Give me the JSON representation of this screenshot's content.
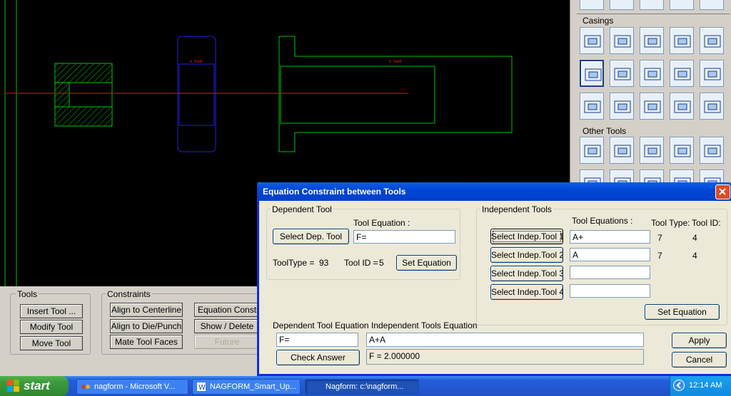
{
  "canvas": {
    "tool_labels": [
      "4. Tool0",
      "5. Tool0"
    ]
  },
  "palette": {
    "casings_title": "Casings",
    "other_tools_title": "Other Tools"
  },
  "bottom_panel": {
    "tools_group": "Tools",
    "insert_tool": "Insert Tool ...",
    "modify_tool": "Modify Tool",
    "move_tool": "Move Tool",
    "constraints_group": "Constraints",
    "align_centerline": "Align to Centerline",
    "align_die_punch": "Align to Die/Punch",
    "mate_tool_faces": "Mate Tool Faces",
    "equation_constraint": "Equation Constraint",
    "show_delete": "Show / Delete",
    "future": "Future"
  },
  "dialog": {
    "title": "Equation Constraint between Tools",
    "dependent_group": "Dependent Tool",
    "tool_equation_label": "Tool Equation :",
    "select_dep_tool": "Select Dep. Tool",
    "dep_equation_value": "F=",
    "tooltype_label": "ToolType =",
    "tooltype_value": "93",
    "toolid_label": "Tool ID =",
    "toolid_value": "5",
    "set_equation_dep": "Set Equation",
    "independent_group": "Independent Tools",
    "tool_equations_header": "Tool Equations :",
    "tool_type_header": "Tool Type:",
    "tool_id_header": "Tool ID:",
    "indep": [
      {
        "button": "Select Indep.Tool 1",
        "equation": "A+",
        "type": "7",
        "id": "4"
      },
      {
        "button": "Select Indep.Tool 2",
        "equation": "A",
        "type": "7",
        "id": "4"
      },
      {
        "button": "Select Indep.Tool 3",
        "equation": "",
        "type": "",
        "id": ""
      },
      {
        "button": "Select Indep.Tool 4",
        "equation": "",
        "type": "",
        "id": ""
      }
    ],
    "set_equation_indep": "Set Equation",
    "dep_tool_equation_label": "Dependent Tool  Equation",
    "indep_tools_equation_label": "Independent Tools Equation",
    "dep_equation_result": "F=",
    "indep_equation_result": "A+A",
    "check_answer": "Check Answer",
    "answer": "F = 2.000000",
    "apply": "Apply",
    "cancel": "Cancel"
  },
  "taskbar": {
    "start": "start",
    "items": [
      "nagform - Microsoft V...",
      "NAGFORM_Smart_Up...",
      "Nagform: c:\\nagform..."
    ],
    "time": "12:14 AM"
  },
  "colors": {
    "canvas_bg": "#000000",
    "green": "#00c000",
    "blue": "#2020e0",
    "red": "#ff0000",
    "dialog_title": "#0a246a",
    "taskbar": "#245edb"
  }
}
